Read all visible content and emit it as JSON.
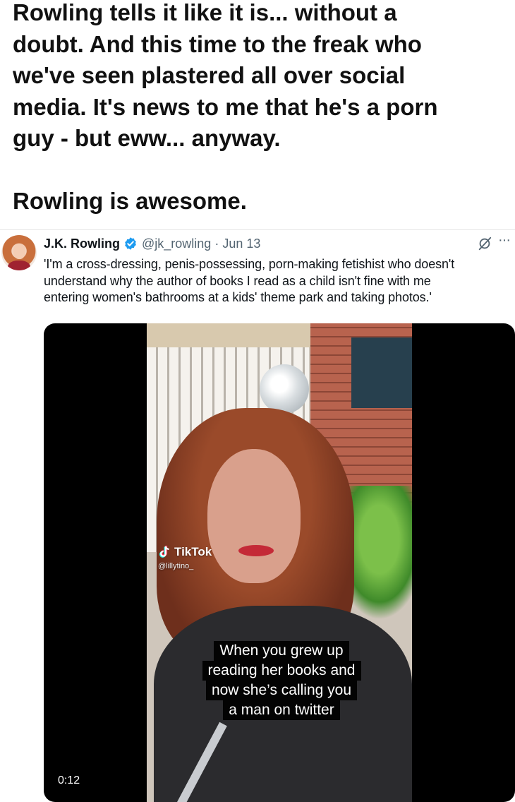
{
  "post": {
    "lines": [
      "Rowling tells it like it is... without a",
      "doubt. And this time to the freak who",
      "we've seen plastered all over social",
      "media. It's news to me that he's a porn",
      "guy - but eww... anyway."
    ],
    "closing": "Rowling is awesome."
  },
  "tweet": {
    "author_name": "J.K. Rowling",
    "handle": "@jk_rowling",
    "separator": "·",
    "date": "Jun 13",
    "more": "···",
    "verified_color": "#1d9bf0",
    "text_lines": [
      "'I'm a cross-dressing, penis-possessing, porn-making fetishist who doesn't",
      "understand why the author of books I read as a child isn't fine with me",
      "entering women's bathrooms at a kids' theme park and taking photos.'"
    ],
    "media": {
      "watermark_brand": "TikTok",
      "watermark_user": "@lillytino_",
      "caption_lines": [
        "When you grew up",
        "reading her books and",
        "now she’s calling you",
        "a man on twitter"
      ],
      "timestamp": "0:12"
    }
  }
}
